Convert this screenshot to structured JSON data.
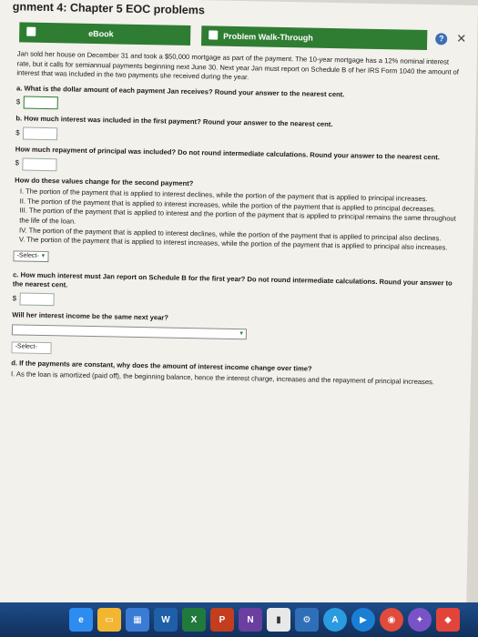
{
  "window": {
    "title": "gnment 4: Chapter 5 EOC problems"
  },
  "tabs": [
    {
      "label": "eBook",
      "icon": "book-icon"
    },
    {
      "label": "Problem Walk-Through",
      "icon": "video-icon"
    }
  ],
  "problem_text": "Jan sold her house on December 31 and took a $50,000 mortgage as part of the payment. The 10-year mortgage has a 12% nominal interest rate, but it calls for semiannual payments beginning next June 30. Next year Jan must report on Schedule B of her IRS Form 1040 the amount of interest that was included in the two payments she received during the year.",
  "questions": {
    "a": "a. What is the dollar amount of each payment Jan receives? Round your answer to the nearest cent.",
    "b": "b. How much interest was included in the first payment? Round your answer to the nearest cent.",
    "principal": "How much repayment of principal was included? Do not round intermediate calculations. Round your answer to the nearest cent.",
    "second_payment": "How do these values change for the second payment?",
    "c": "c. How much interest must Jan report on Schedule B for the first year? Do not round intermediate calculations. Round your answer to the nearest cent.",
    "next_year": "Will her interest income be the same next year?",
    "d": "d. If the payments are constant, why does the amount of interest income change over time?"
  },
  "answer_prefix": "$",
  "choices": [
    "I. The portion of the payment that is applied to interest declines, while the portion of the payment that is applied to principal increases.",
    "II. The portion of the payment that is applied to interest increases, while the portion of the payment that is applied to principal decreases.",
    "III. The portion of the payment that is applied to interest and the portion of the payment that is applied to principal remains the same throughout the life of the loan.",
    "IV. The portion of the payment that is applied to interest declines, while the portion of the payment that is applied to principal also declines.",
    "V. The portion of the payment that is applied to interest increases, while the portion of the payment that is applied to principal also increases."
  ],
  "selects": {
    "second_payment_value": "-Select-",
    "next_year_value": "",
    "d_value": "-Select-"
  },
  "d_partial": "I. As the loan is amortized (paid off), the beginning balance, hence the interest charge, increases and the repayment of principal increases."
}
